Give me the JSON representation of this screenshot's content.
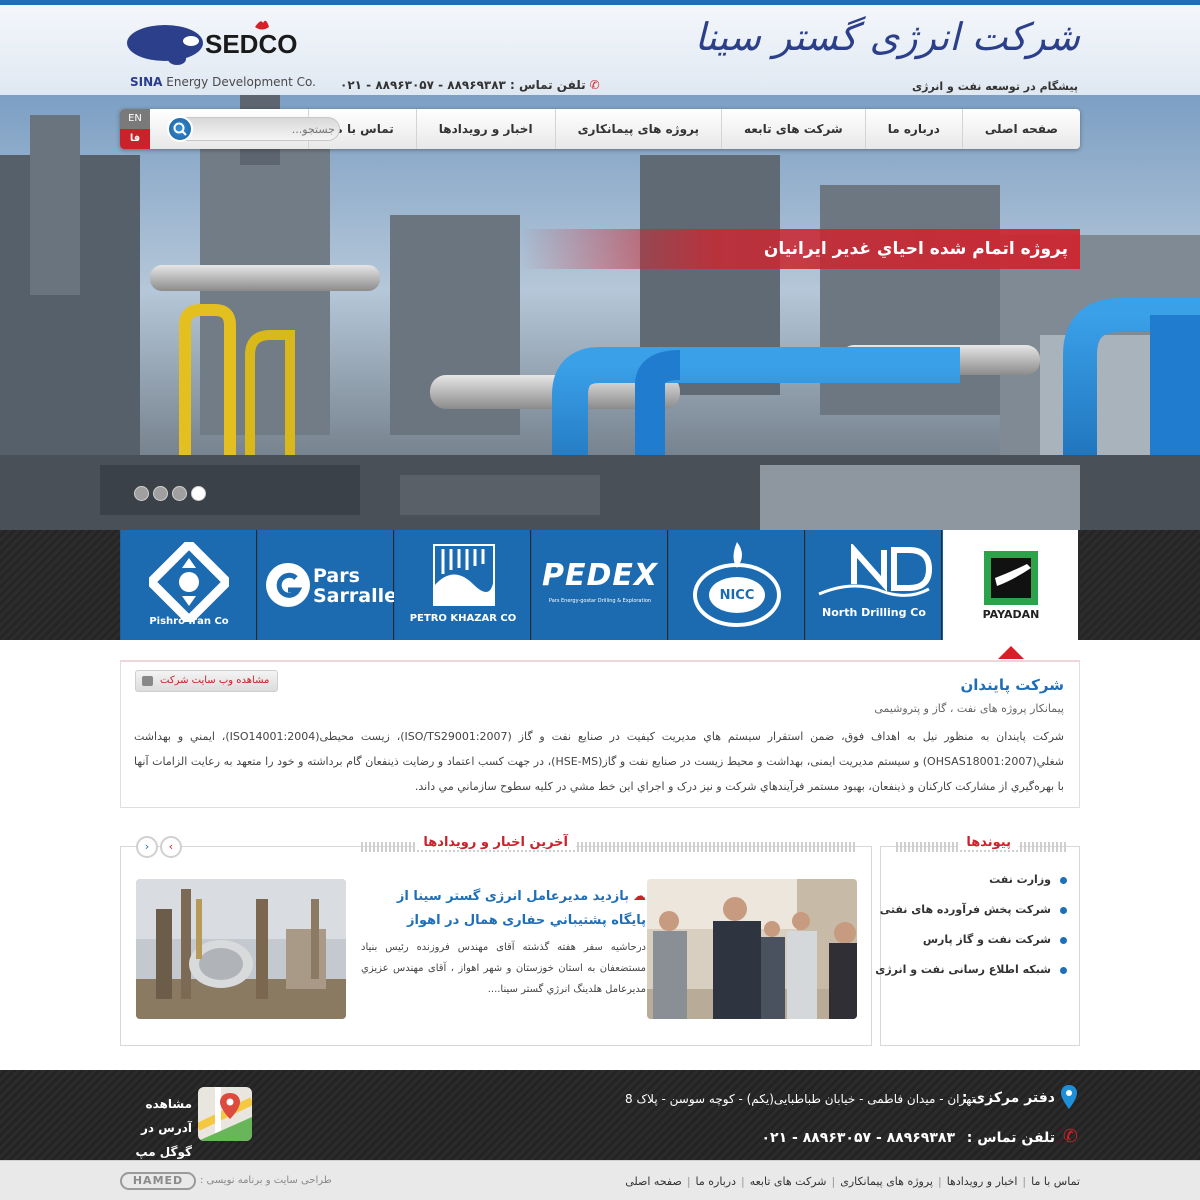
{
  "header": {
    "logo_text": "SEDCO",
    "logo_sub_bold": "SINA",
    "logo_sub": " Energy Development Co.",
    "brand_fa": "شرکت انرژی گستر سینا",
    "tagline": "پیشگام در توسعه نفت و انرژی",
    "phone": "تلفن تماس :  ۸۸۹۶۹۳۸۳ - ۸۸۹۶۳۰۵۷ - ۰۲۱"
  },
  "nav": {
    "items": [
      "صفحه اصلی",
      "درباره ما",
      "شرکت های تابعه",
      "پروژه های پیمانکاری",
      "اخبار و رویدادها",
      "تماس با ما"
    ],
    "search_placeholder": "جستجو...",
    "lang_en": "EN",
    "lang_fa": "فا"
  },
  "slider": {
    "caption": "پروژه اتمام شده احياي غدير ايرانيان",
    "dots": 4,
    "active_dot": 4
  },
  "companies": [
    {
      "name": "Pishro Iran Co",
      "active": false
    },
    {
      "name": "Pars Sarralle",
      "active": false
    },
    {
      "name": "PETRO KHAZAR CO",
      "active": false
    },
    {
      "name": "PEDEX",
      "sub": "Pars Energy-gostar Drilling & Exploration",
      "active": false
    },
    {
      "name": "NICC",
      "active": false
    },
    {
      "name": "North Drilling Co",
      "active": false
    },
    {
      "name": "PAYADAN",
      "active": true
    }
  ],
  "info": {
    "title": "شرکت پایندان",
    "subtitle": "پیمانکار پروژه های نفت ، گاز و پتروشیمی",
    "body": "شرکت پایندان به منظور نیل به اهداف فوق، ضمن استقرار سیستم هاي مديريت كيفيت در صنايع نفت و گاز (ISO/TS29001:2007)، زیست محیطی(ISO14001:2004)، ايمني و بهداشت شغلي(OHSAS18001:2007) و سیستم مدیریت ایمنی، بهداشت و محیط زیست در صنایع نفت و گاز(HSE-MS)، در جهت کسب اعتماد و رضايت ذينفعان گام برداشته و خود را متعهد به رعايت الزامات آنها با بهره‌گيري از مشارکت کارکنان و ذينفعان، بهبود مستمر فرآيندهاي شرکت و نيز درک و اجراي اين خط مشي در کليه سطوح سازماني مي داند.",
    "visit_label": "مشاهده وب سایت شرکت"
  },
  "links": {
    "title": "پیوندها",
    "items": [
      "وزارت نفت",
      "شرکت پخش فرآورده های نفتی",
      "شرکت نفت و گاز پارس",
      "شبکه اطلاع رسانی نفت و انرژی"
    ]
  },
  "news": {
    "title": "آخرین اخبار و رویدادها",
    "headline": "بازدید مدیرعامل انرژی گستر سینا از پایگاه پشتيباني حفاری همال در اهواز",
    "excerpt": "درحاشیه سفر هفته گذشته آقای مهندس فروزنده رئیس بنیاد مستضعفان به استان خوزستان و شهر اهواز ، آقای مهندس عزیزي مدیرعامل هلدینگ انرژي گستر سینا....",
    "prev": "›",
    "next": "‹"
  },
  "footer": {
    "address_label": "دفتر مرکزی :",
    "address_value": "تهران - میدان فاطمی - خیابان طباطبایی(یکم) - کوچه سوسن - پلاک 8",
    "phone_label": "تلفن تماس :",
    "phone_value": "۰۲۱ - ۸۸۹۶۳۰۵۷ - ۸۸۹۶۹۳۸۳",
    "maps_label": "مشاهده آدرس در گوگل مپ",
    "bottom_links": [
      "صفحه اصلی",
      "درباره ما",
      "شرکت های تابعه",
      "پروژه های پیمانکاری",
      "اخبار و رویدادها",
      "تماس با ما"
    ],
    "designer": "طراحی سایت و برنامه نویسی :",
    "designer_logo": "HAMED"
  },
  "colors": {
    "brand_blue": "#1f6fb8",
    "accent_red": "#c9222a",
    "dark": "#2a2a2a"
  }
}
